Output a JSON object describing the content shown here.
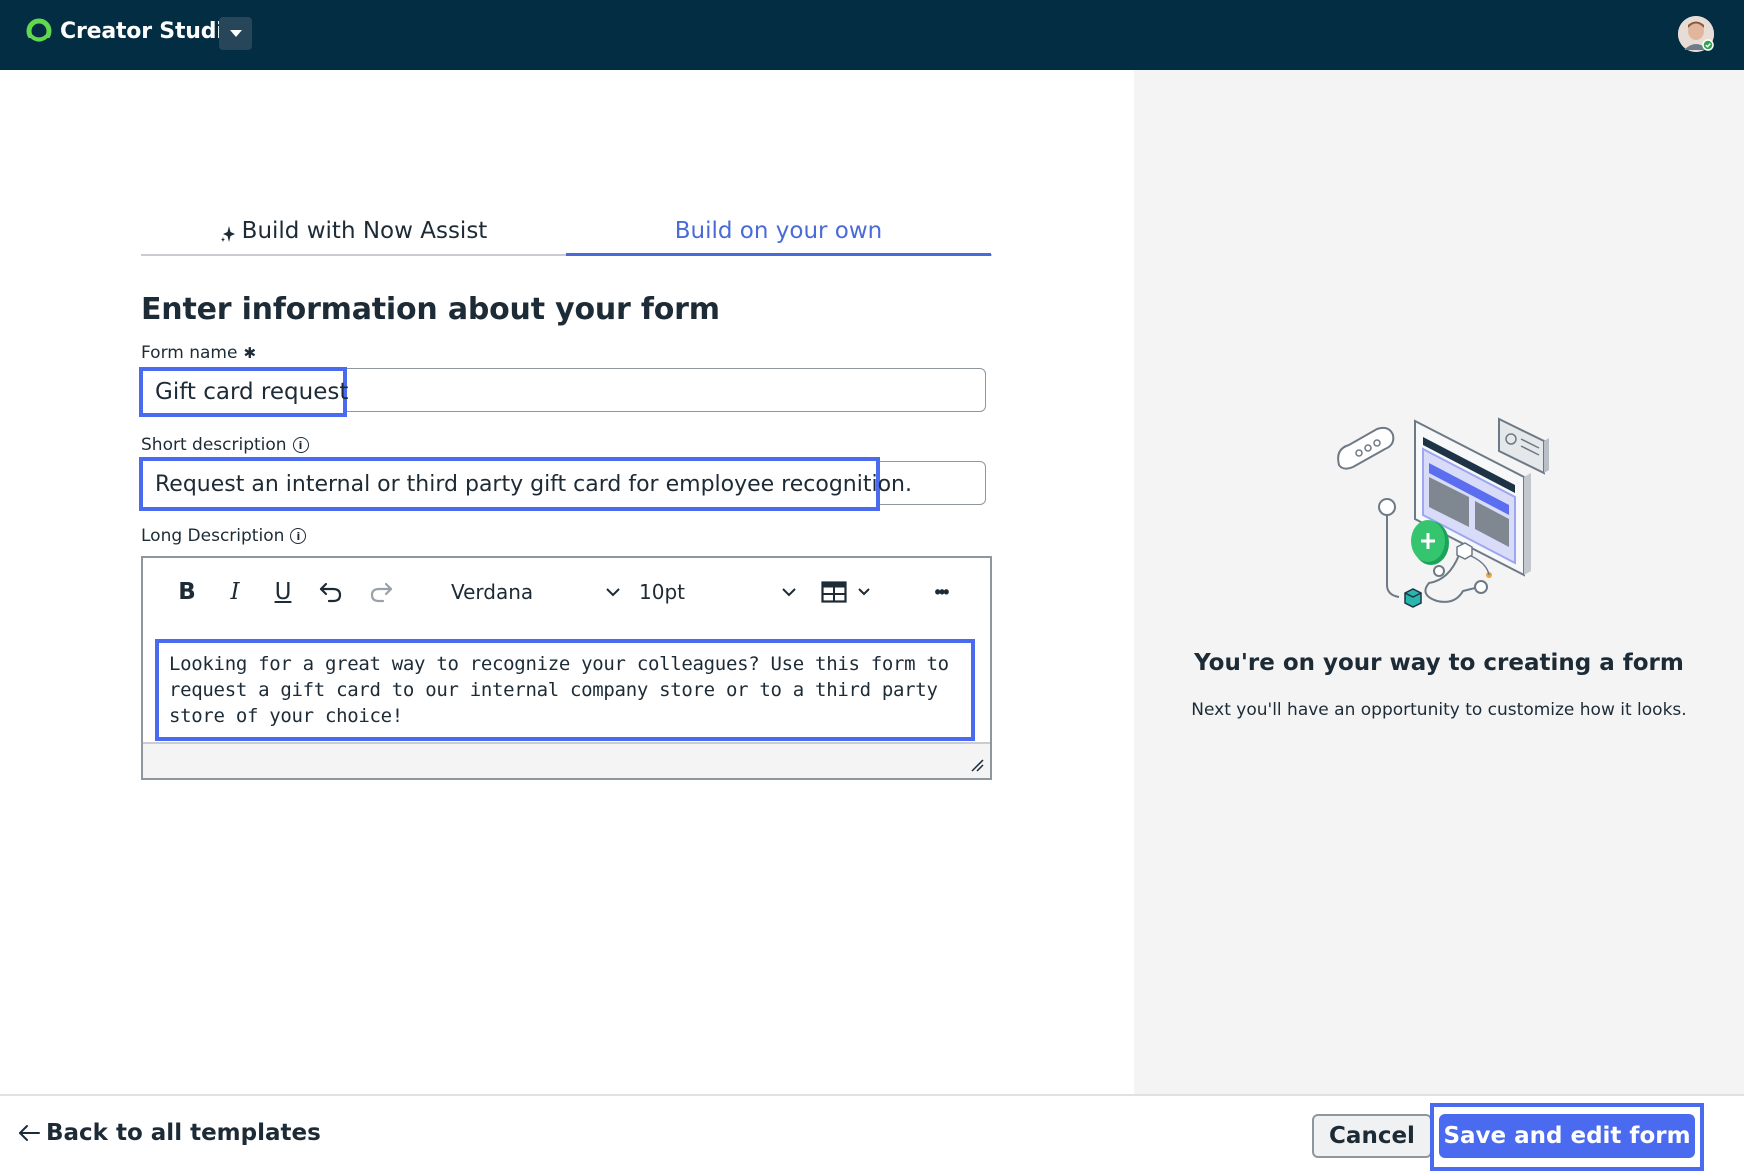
{
  "app": {
    "name": "Creator Studio",
    "icons": {
      "logo": "servicenow-logo-icon",
      "caret": "caret-down-icon",
      "avatar": "user-avatar"
    }
  },
  "tabs": [
    {
      "label": "Build with Now Assist",
      "icon": "sparkle-icon",
      "active": false
    },
    {
      "label": "Build on your own",
      "active": true
    }
  ],
  "form": {
    "heading": "Enter information about your form",
    "name": {
      "label": "Form name",
      "required_mark": "✱",
      "value": "Gift card request"
    },
    "short_description": {
      "label": "Short description",
      "info": "i",
      "value": "Request an internal or third party gift card for employee recognition."
    },
    "long_description": {
      "label": "Long Description",
      "info": "i",
      "toolbar": {
        "bold": "B",
        "italic": "I",
        "underline": "U",
        "font": "Verdana",
        "size": "10pt",
        "more": "•••"
      },
      "value": "Looking for a great way to recognize your colleagues? Use this form to request a gift card to our internal company store or to a third party store of your choice!"
    }
  },
  "side_panel": {
    "title": "You're on your way to creating a form",
    "subtitle": "Next you'll have an opportunity to customize how it looks."
  },
  "footer": {
    "back_label": "Back to all templates",
    "cancel_label": "Cancel",
    "save_label": "Save and edit form"
  },
  "colors": {
    "topbar": "#032d42",
    "accent": "#4a6bf0",
    "tab_active": "#4a6bd7",
    "panel_bg": "#f4f4f4",
    "logo_green": "#62d84e"
  }
}
